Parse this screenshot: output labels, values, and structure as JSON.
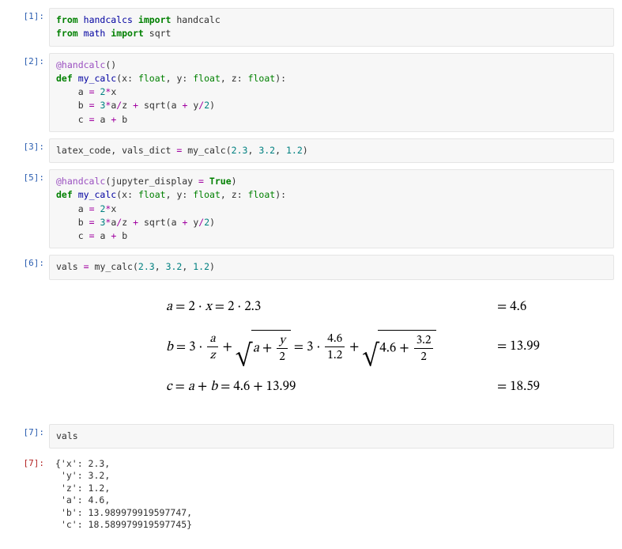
{
  "cells": {
    "c1": {
      "prompt": "[1]:"
    },
    "c2": {
      "prompt": "[2]:"
    },
    "c3": {
      "prompt": "[3]:"
    },
    "c5": {
      "prompt": "[5]:"
    },
    "c6": {
      "prompt": "[6]:"
    },
    "c7in": {
      "prompt": "[7]:"
    },
    "c7out": {
      "prompt": "[7]:"
    }
  },
  "tok": {
    "from": "from",
    "import": "import",
    "def": "def",
    "handcalcs": "handcalcs",
    "handcalc": "handcalc",
    "math": "math",
    "sqrt": "sqrt",
    "dec_handcalc_open": "@handcalc",
    "kw_jupyter_display": "jupyter_display",
    "True": "True",
    "my_calc": "my_calc",
    "x": "x",
    "y": "y",
    "z": "z",
    "a": "a",
    "b": "b",
    "c": "c",
    "float": "float",
    "latex_code": "latex_code",
    "vals_dict": "vals_dict",
    "vals": "vals",
    "eq": "=",
    "plus": "+",
    "mul": "*",
    "slash": "/",
    "colon": ":",
    "comma": ",",
    "lparen": "(",
    "rparen": ")",
    "num2": "2",
    "num3": "3",
    "num2_3": "2.3",
    "num3_2": "3.2",
    "num1_2": "1.2"
  },
  "math": {
    "row_a_lhs_1": "a",
    "row_a_eq": " = ",
    "row_a_2": "2",
    "row_a_dot": " · ",
    "row_a_x": "x",
    "row_a_2_3": "2.3",
    "row_a_rhs": "= 4.6",
    "row_b_b": "b",
    "row_b_3": "3",
    "row_b_a": "a",
    "row_b_z": "z",
    "row_b_y": "y",
    "row_b_2": "2",
    "row_b_4_6": "4.6",
    "row_b_1_2": "1.2",
    "row_b_3_2": "3.2",
    "row_b_rhs": "= 13.99",
    "row_c_c": "c",
    "row_c_a": "a",
    "row_c_b": "b",
    "row_c_4_6": "4.6",
    "row_c_13_99": "13.99",
    "row_c_rhs": "= 18.59"
  },
  "output7": "{'x': 2.3,\n 'y': 3.2,\n 'z': 1.2,\n 'a': 4.6,\n 'b': 13.989979919597747,\n 'c': 18.589979919597745}"
}
